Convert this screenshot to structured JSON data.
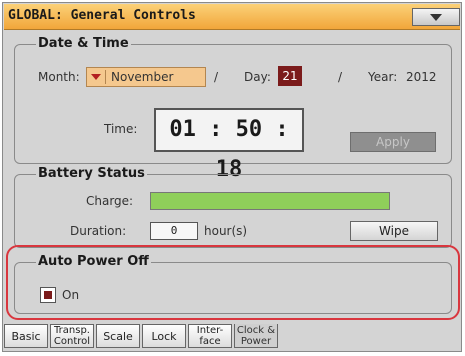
{
  "window": {
    "title": "GLOBAL: General Controls"
  },
  "date_time": {
    "group_title": "Date & Time",
    "month_label": "Month:",
    "month_value": "November",
    "day_label": "Day:",
    "day_value": "21",
    "year_label": "Year:",
    "year_value": "2012",
    "time_label": "Time:",
    "time_value": "01 : 50 : 18",
    "apply_label": "Apply",
    "separator": "/"
  },
  "battery": {
    "group_title": "Battery Status",
    "charge_label": "Charge:",
    "charge_fraction": 1.0,
    "duration_label": "Duration:",
    "duration_value": "0",
    "duration_unit": "hour(s)",
    "wipe_label": "Wipe"
  },
  "auto_power": {
    "group_title": "Auto Power Off",
    "checkbox_label": "On",
    "checked": true
  },
  "tabs": [
    {
      "label": "Basic",
      "active": false
    },
    {
      "label": "Transp. Control",
      "active": false
    },
    {
      "label": "Scale",
      "active": false
    },
    {
      "label": "Lock",
      "active": false
    },
    {
      "label": "Inter- face",
      "active": false
    },
    {
      "label": "Clock & Power",
      "active": true
    }
  ],
  "colors": {
    "title_bar": "#f1a63a",
    "dropdown": "#f5c88e",
    "day_highlight": "#7b1b1b",
    "charge_fill": "#8fcf5a",
    "highlight_outline": "#d9363e"
  }
}
